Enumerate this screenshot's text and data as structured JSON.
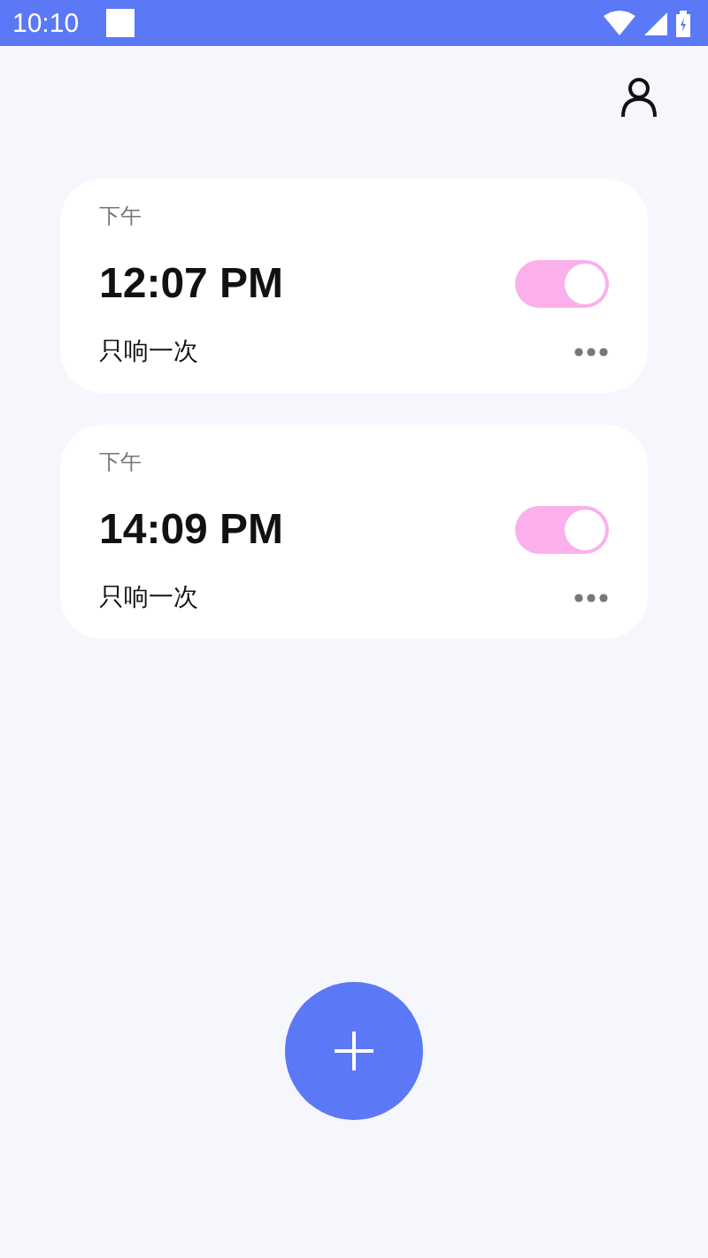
{
  "status_bar": {
    "time": "10:10"
  },
  "alarms": [
    {
      "period": "下午",
      "time": "12:07 PM",
      "repeat": "只响一次",
      "on": true
    },
    {
      "period": "下午",
      "time": "14:09 PM",
      "repeat": "只响一次",
      "on": true
    }
  ]
}
